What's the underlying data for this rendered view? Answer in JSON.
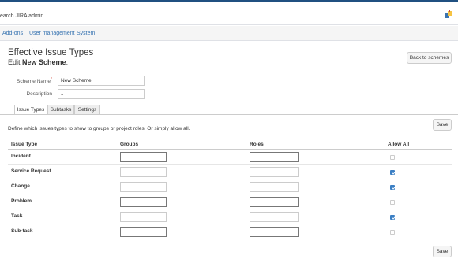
{
  "header": {
    "search_text": "earch JIRA admin",
    "icon": "add-ons-icon"
  },
  "nav": {
    "items": [
      "Add-ons",
      "User management",
      "System"
    ]
  },
  "page": {
    "title": "Effective Issue Types",
    "subtitle_prefix": "Edit",
    "subtitle_name": "New Scheme",
    "subtitle_suffix": ":",
    "back_button": "Back to schemes"
  },
  "form": {
    "scheme_name_label": "Scheme Name",
    "required_mark": "*",
    "scheme_name_value": "New Scheme",
    "description_label": "Description",
    "description_value": ".."
  },
  "tabs": [
    "Issue Types",
    "Subtasks",
    "Settings"
  ],
  "active_tab": "Issue Types",
  "description_text": "Define which issues types to show to groups or project roles. Or simply allow all.",
  "save_label": "Save",
  "table": {
    "headers": [
      "Issue Type",
      "Groups",
      "Roles",
      "Allow All"
    ],
    "rows": [
      {
        "label": "Incident",
        "allow_all": false
      },
      {
        "label": "Service Request",
        "allow_all": true
      },
      {
        "label": "Change",
        "allow_all": true
      },
      {
        "label": "Problem",
        "allow_all": false
      },
      {
        "label": "Task",
        "allow_all": true
      },
      {
        "label": "Sub-task",
        "allow_all": false
      }
    ]
  },
  "colors": {
    "link": "#3572b0",
    "checkbox_checked": "#3b7fc4",
    "topbar": "#205081"
  }
}
